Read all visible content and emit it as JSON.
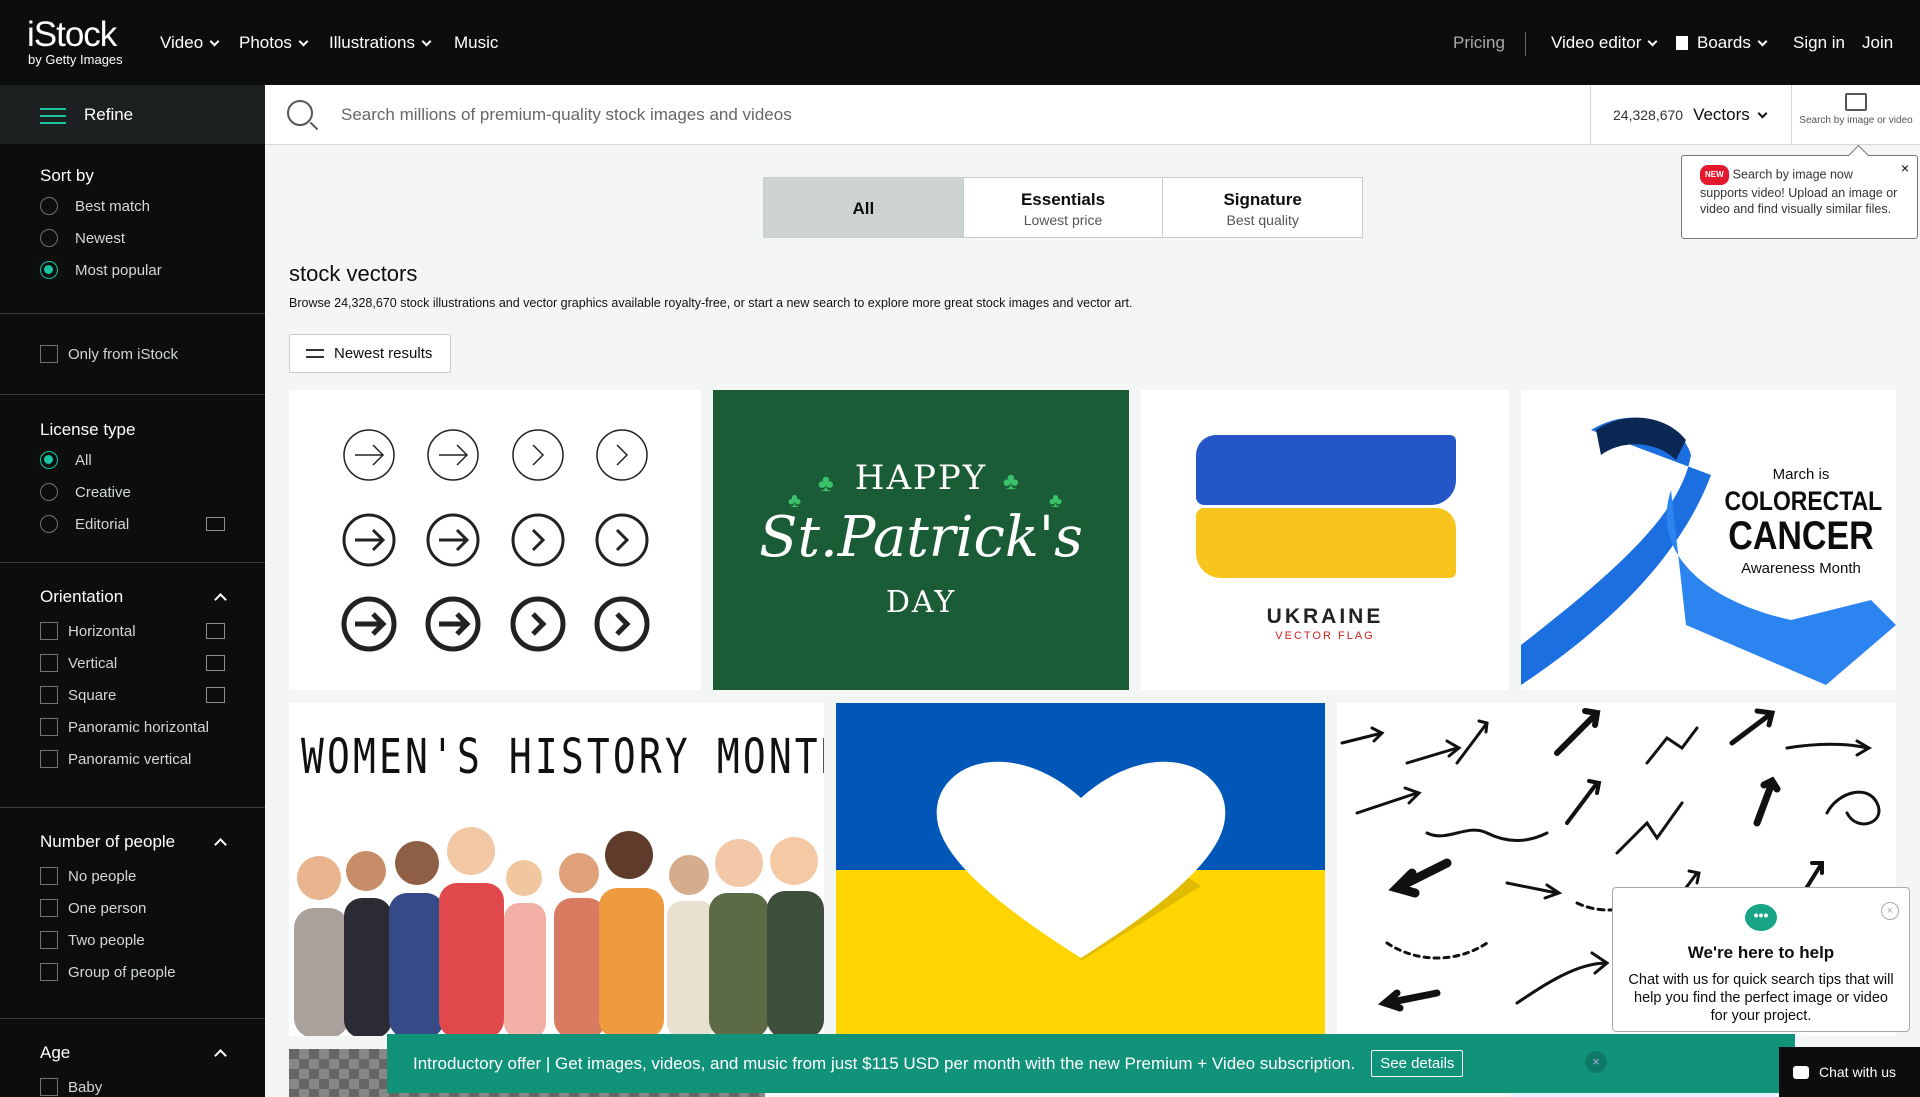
{
  "header": {
    "logo_main": "iStock",
    "logo_sub": "by Getty Images",
    "nav": [
      "Video",
      "Photos",
      "Illustrations",
      "Music"
    ],
    "pricing": "Pricing",
    "video_editor": "Video editor",
    "boards": "Boards",
    "sign_in": "Sign in",
    "join": "Join"
  },
  "sidebar": {
    "refine": "Refine",
    "sort_title": "Sort by",
    "sort_options": [
      "Best match",
      "Newest",
      "Most popular"
    ],
    "only_istock": "Only from iStock",
    "license_title": "License type",
    "license_options": [
      "All",
      "Creative",
      "Editorial"
    ],
    "orientation_title": "Orientation",
    "orientation_options": [
      "Horizontal",
      "Vertical",
      "Square",
      "Panoramic horizontal",
      "Panoramic vertical"
    ],
    "people_title": "Number of people",
    "people_options": [
      "No people",
      "One person",
      "Two people",
      "Group of people"
    ],
    "age_title": "Age",
    "age_options": [
      "Baby"
    ]
  },
  "search": {
    "placeholder": "Search millions of premium-quality stock images and videos",
    "count": "24,328,670",
    "category": "Vectors",
    "search_by_image": "Search by image or video"
  },
  "tabs": [
    {
      "title": "All",
      "subtitle": ""
    },
    {
      "title": "Essentials",
      "subtitle": "Lowest price"
    },
    {
      "title": "Signature",
      "subtitle": "Best quality"
    }
  ],
  "tooltip": {
    "badge": "NEW",
    "text": "Search by image now supports video! Upload an image or video and find visually similar files.",
    "close": "×"
  },
  "page": {
    "title": "stock vectors",
    "subtitle": "Browse 24,328,670 stock illustrations and vector graphics available royalty-free, or start a new search to explore more great stock images and vector art.",
    "newest_button": "Newest results"
  },
  "images": {
    "patrick": {
      "line1": "HAPPY",
      "line2": "St.Patrick's",
      "line3": "DAY"
    },
    "ukraine": {
      "title": "UKRAINE",
      "subtitle": "VECTOR FLAG"
    },
    "colorectal": {
      "line1": "March is",
      "line2": "COLORECTAL",
      "line3": "CANCER",
      "line4": "Awareness Month"
    },
    "women": {
      "title": "WOMEN'S HISTORY MONTH"
    }
  },
  "banner": {
    "text": "Introductory offer | Get images, videos, and music from just $115 USD per month with the new Premium + Video subscription.",
    "button": "See details",
    "close": "×"
  },
  "chat": {
    "title": "We're here to help",
    "text": "Chat with us for quick search tips that will help you find the perfect image or video for your project.",
    "button": "Chat with us",
    "close": "×",
    "bubble": "•••"
  }
}
